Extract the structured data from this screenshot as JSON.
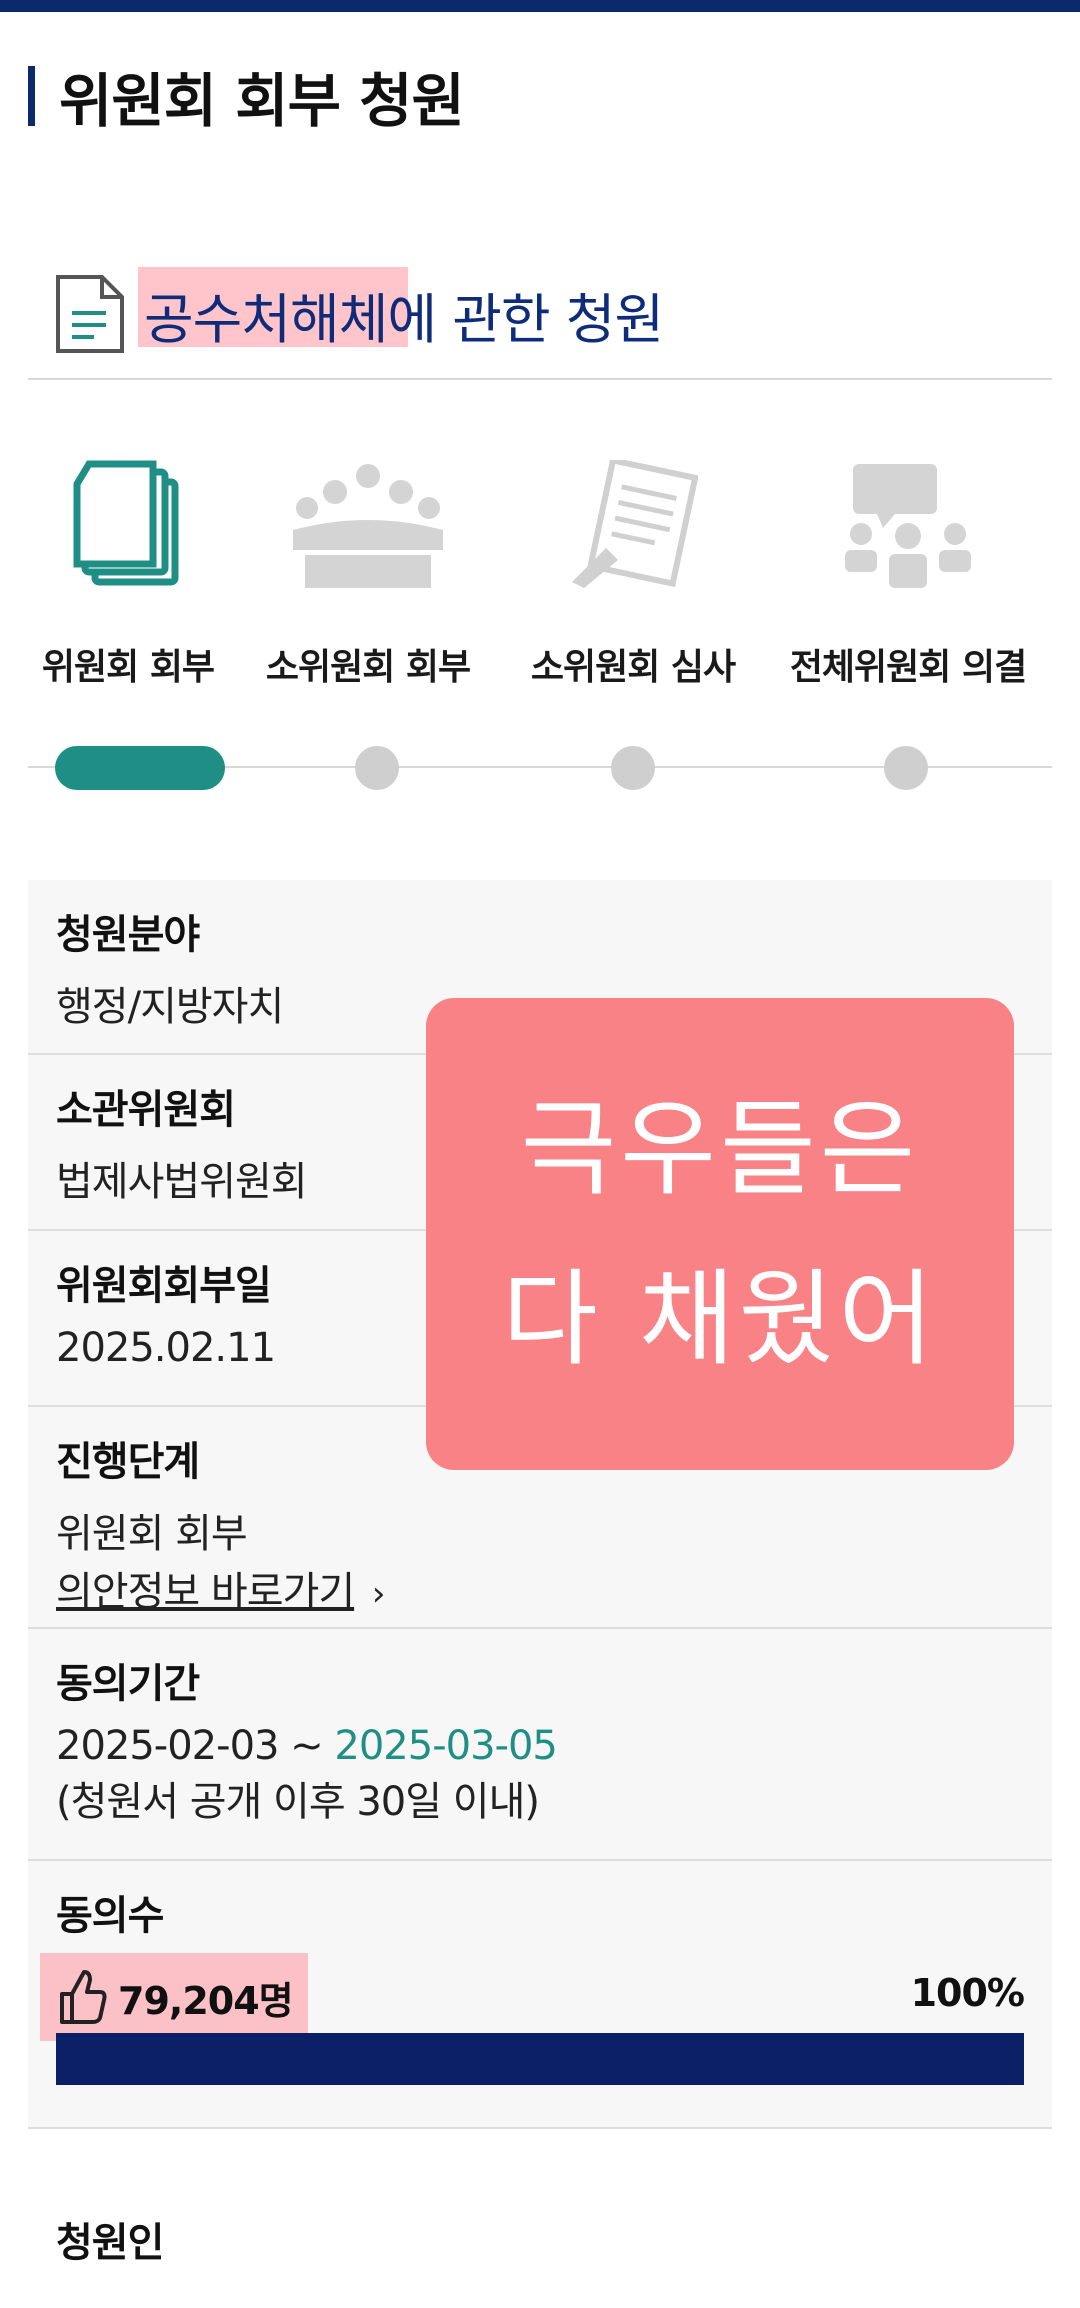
{
  "page": {
    "title": "위원회 회부 청원"
  },
  "petition": {
    "title_highlight": "공수처해체",
    "title_rest": "에 관한 청원"
  },
  "steps": [
    {
      "label": "위원회 회부",
      "icon": "documents-icon",
      "active": true
    },
    {
      "label": "소위원회 회부",
      "icon": "meeting-icon",
      "active": false
    },
    {
      "label": "소위원회 심사",
      "icon": "review-icon",
      "active": false
    },
    {
      "label": "전체위원회 의결",
      "icon": "vote-icon",
      "active": false
    }
  ],
  "info": {
    "field_label": "청원분야",
    "field_value": "행정/지방자치",
    "committee_label": "소관위원회",
    "committee_value": "법제사법위원회",
    "referral_label": "위원회회부일",
    "referral_value": "2025.02.11",
    "stage_label": "진행단계",
    "stage_value": "위원회 회부",
    "stage_link": "의안정보 바로가기",
    "period_label": "동의기간",
    "period_start": "2025-02-03 ~ ",
    "period_end": "2025-03-05",
    "period_note": "(청원서 공개 이후 30일 이내)",
    "consent_label": "동의수",
    "consent_count": "79,204명",
    "consent_percent": "100%",
    "consent_progress": 100
  },
  "petitioner_label": "청원인",
  "sticker": {
    "line1": "극우들은",
    "line2": "다 채웠어"
  },
  "colors": {
    "navy": "#0b2a6b",
    "teal": "#1f8f86",
    "sticker": "#f88286",
    "highlight": "#ff96a0"
  }
}
